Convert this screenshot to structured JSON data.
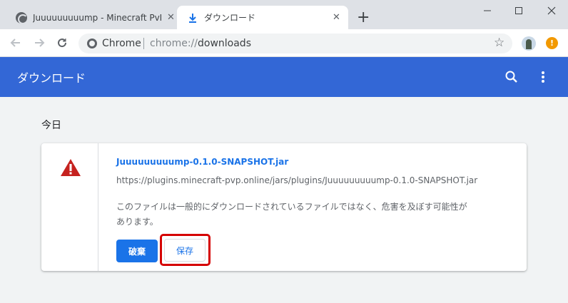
{
  "tabs": [
    {
      "title": "Juuuuuuuuump - Minecraft PvP (",
      "close": "✕",
      "icon": "globe-icon"
    },
    {
      "title": "ダウンロード",
      "close": "✕",
      "icon": "download-icon"
    }
  ],
  "new_tab_label": "+",
  "window_controls": {
    "minimize": "—",
    "maximize": "☐",
    "close": "✕"
  },
  "nav": {
    "back": "←",
    "forward": "→",
    "reload": "↻"
  },
  "omnibox": {
    "site_label": "Chrome",
    "url_scheme": "chrome://",
    "url_path": "downloads"
  },
  "toolbar": {
    "star": "☆",
    "alert": "!"
  },
  "header": {
    "title": "ダウンロード"
  },
  "downloads": {
    "day_label": "今日",
    "items": [
      {
        "file_name": "Juuuuuuuuump-0.1.0-SNAPSHOT.jar",
        "url": "https://plugins.minecraft-pvp.online/jars/plugins/Juuuuuuuuump-0.1.0-SNAPSHOT.jar",
        "warning": "このファイルは一般的にダウンロードされているファイルではなく、危害を及ぼす可能性があります。",
        "discard_label": "破棄",
        "keep_label": "保存"
      }
    ]
  },
  "colors": {
    "header": "#3367d6",
    "accent": "#1a73e8",
    "warning": "#c5221f",
    "highlight": "#d50000"
  }
}
